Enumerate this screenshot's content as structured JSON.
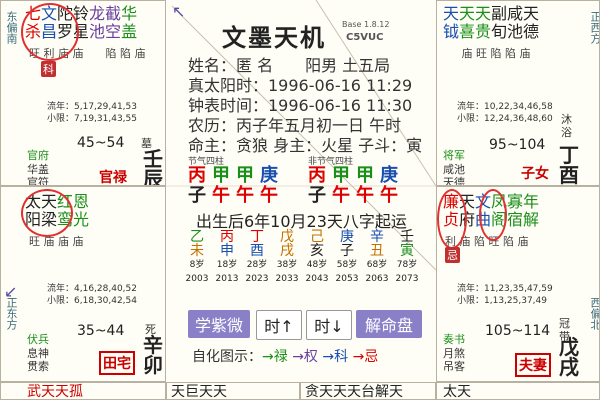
{
  "center": {
    "title": "文墨天机",
    "version": "Base 1.8.12",
    "code": "C5VUC",
    "lines": [
      "姓名：匿 名　　阳男 土五局",
      "真太阳时：1996-06-16 11:29",
      "钟表时间：1996-06-16 11:30",
      "农历：丙子年五月初一日 午时",
      "命主：贪狼 身主：火星 子斗：寅"
    ],
    "jieqi_label": "节气四柱",
    "feijieqi_label": "非节气四柱",
    "jieqi": [
      [
        "丙",
        "子"
      ],
      [
        "甲",
        "午"
      ],
      [
        "甲",
        "午"
      ],
      [
        "庚",
        "午"
      ]
    ],
    "feijieqi": [
      [
        "丙",
        "子"
      ],
      [
        "甲",
        "午"
      ],
      [
        "甲",
        "午"
      ],
      [
        "庚",
        "午"
      ]
    ],
    "qiyun": "出生后6年10月23天八字起运",
    "dayun_top": [
      "乙",
      "丙",
      "丁",
      "戊",
      "己",
      "庚",
      "辛",
      "壬"
    ],
    "dayun_bottom": [
      "未",
      "申",
      "酉",
      "戌",
      "亥",
      "子",
      "丑",
      "寅"
    ],
    "ages": [
      "8岁",
      "18岁",
      "28岁",
      "38岁",
      "48岁",
      "58岁",
      "68岁",
      "78岁"
    ],
    "years": [
      "2003",
      "2013",
      "2023",
      "2033",
      "2043",
      "2053",
      "2063",
      "2073"
    ],
    "buttons": [
      "学紫微",
      "时↑",
      "时↓",
      "解命盘"
    ],
    "legend": "自化图示：→禄 →权 →科 →忌"
  },
  "cells": {
    "tl": {
      "stars": [
        "七杀",
        "文昌",
        "陀罗",
        "铃星",
        "龙池",
        "截空",
        "华盖"
      ],
      "bright": [
        "旺",
        "利",
        "庙",
        "庙",
        "",
        "",
        ""
      ],
      "liu": "流年：5,17,29,41,53",
      "xiao": "小限：7,19,31,43,55",
      "range": "45~54",
      "ps": "官禄",
      "branch": "壬辰",
      "sub1": "官府",
      "sub2": "华盖",
      "sub3": "官符",
      "mu": "墓",
      "side": "东偏南"
    },
    "ml": {
      "stars": [
        "太阳",
        "天梁",
        "红鸾",
        "恩光"
      ],
      "bright": [
        "旺",
        "庙",
        "庙",
        "庙"
      ],
      "liu": "流年：4,16,28,40,52",
      "xiao": "小限：6,18,30,42,54",
      "range": "35~44",
      "ps": "田宅",
      "branch": "辛卯",
      "sub1": "伏兵",
      "sub2": "息神",
      "sub3": "贯索",
      "mu": "死",
      "side": "正东方"
    },
    "tr": {
      "stars": [
        "天钺",
        "天喜",
        "天贵",
        "副旬",
        "咸池",
        "天德"
      ],
      "bright": [
        "",
        "庙",
        "旺",
        "",
        "",
        ""
      ],
      "liu": "流年：10,22,34,46,58",
      "xiao": "小限：12,24,36,48,60",
      "range": "95~104",
      "ps": "子女",
      "branch": "丁酉",
      "sub1": "将军",
      "sub2": "咸池",
      "sub3": "天德",
      "mu": "沐浴",
      "side": "正西方"
    },
    "mr": {
      "stars": [
        "廉贞",
        "天府",
        "文曲",
        "凤阁",
        "寡宿",
        "年解"
      ],
      "bright": [
        "利",
        "庙",
        "陷",
        "",
        "",
        ""
      ],
      "liu": "流年：11,23,35,47,59",
      "xiao": "小限：1,13,25,37,49",
      "range": "105~114",
      "ps": "夫妻",
      "branch": "戊戌",
      "sub1": "奏书",
      "sub2": "月煞",
      "sub3": "吊客",
      "mu": "冠带",
      "side": "西偏北"
    },
    "bottom_left": "武天天孤",
    "bottom_mid1": "天巨天天",
    "bottom_mid2": "贪天天天台解天",
    "bottom_right": "太天"
  }
}
